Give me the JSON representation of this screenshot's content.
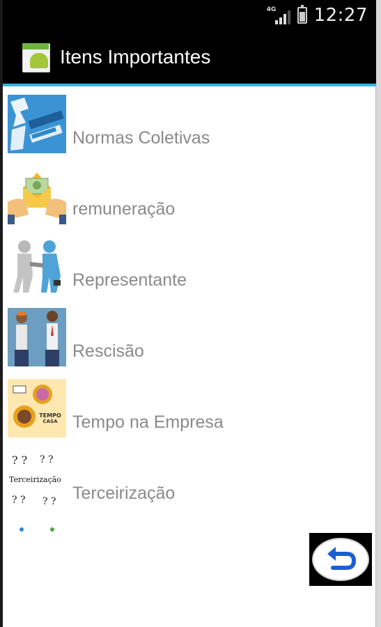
{
  "status_bar": {
    "network": "4G",
    "time": "12:27"
  },
  "action_bar": {
    "title": "Itens Importantes",
    "app_icon": "android-app-icon",
    "accent": "#33b5e5"
  },
  "list": {
    "items": [
      {
        "label": "Normas Coletivas",
        "icon": "normas-coletivas-thumbnail"
      },
      {
        "label": "remuneração",
        "icon": "money-envelope-thumbnail"
      },
      {
        "label": "Representante",
        "icon": "handshake-thumbnail"
      },
      {
        "label": "Rescisão",
        "icon": "two-workers-thumbnail"
      },
      {
        "label": "Tempo na Empresa",
        "icon": "tempo-casa-thumbnail"
      },
      {
        "label": "Terceirização",
        "icon": "terceirizacao-thumbnail",
        "thumb_text": "Terceirização"
      }
    ]
  },
  "back_button": {
    "icon": "undo-arrow-icon",
    "color": "#1c5fd1"
  }
}
